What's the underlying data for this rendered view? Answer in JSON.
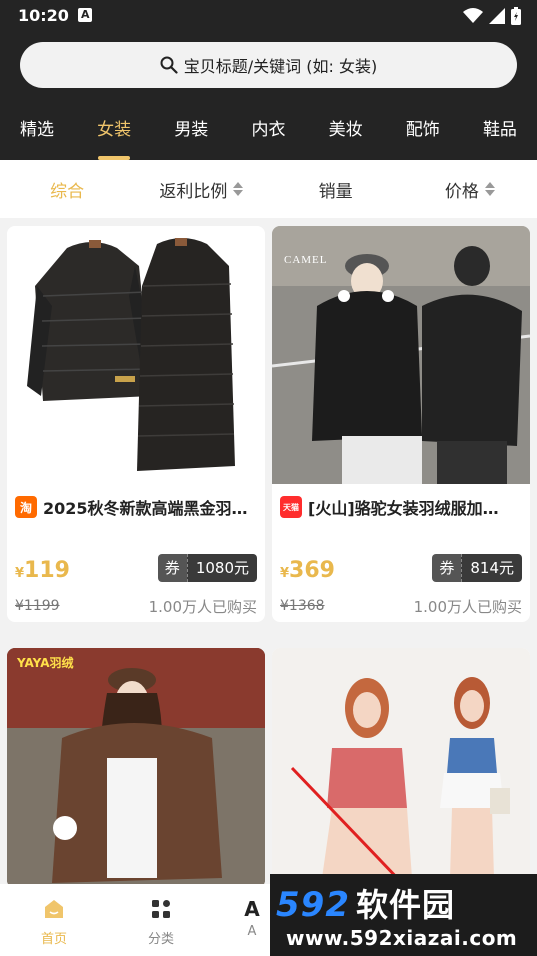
{
  "status": {
    "time": "10:20"
  },
  "search": {
    "placeholder": "宝贝标题/关键词 (如: 女装)"
  },
  "tabs": [
    "精选",
    "女装",
    "男装",
    "内衣",
    "美妆",
    "配饰",
    "鞋品"
  ],
  "active_tab": "女装",
  "sort": {
    "items": [
      "综合",
      "返利比例",
      "销量",
      "价格"
    ],
    "active": "综合"
  },
  "products": [
    {
      "shop": "淘",
      "shop_color": "#ff6a00",
      "title": "2025秋冬新款高端黑金羽…",
      "price_cur": "¥",
      "price": "119",
      "coupon_label": "券",
      "coupon_value": "1080元",
      "original_price": "¥1199",
      "sold": "1.00万人已购买"
    },
    {
      "shop": "天猫",
      "shop_color": "#ff2d2d",
      "title": "[火山]骆驼女装羽绒服加…",
      "price_cur": "¥",
      "price": "369",
      "coupon_label": "券",
      "coupon_value": "814元",
      "original_price": "¥1368",
      "sold": "1.00万人已购买"
    }
  ],
  "product_images": {
    "img1_logo": "",
    "img2_brand": "CAMEL",
    "img3_sign": "YAYA羽绒"
  },
  "bottom_nav": [
    {
      "label": "首页",
      "icon": "home-icon"
    },
    {
      "label": "分类",
      "icon": "category-icon"
    },
    {
      "label": "A",
      "icon": "ai-icon"
    }
  ],
  "watermark": {
    "top_num": "592",
    "top_cn": "软件园",
    "bottom": "www.592xiazai.com"
  },
  "colors": {
    "accent": "#f0c56b",
    "price": "#e9b84d",
    "header_bg": "#242424"
  }
}
